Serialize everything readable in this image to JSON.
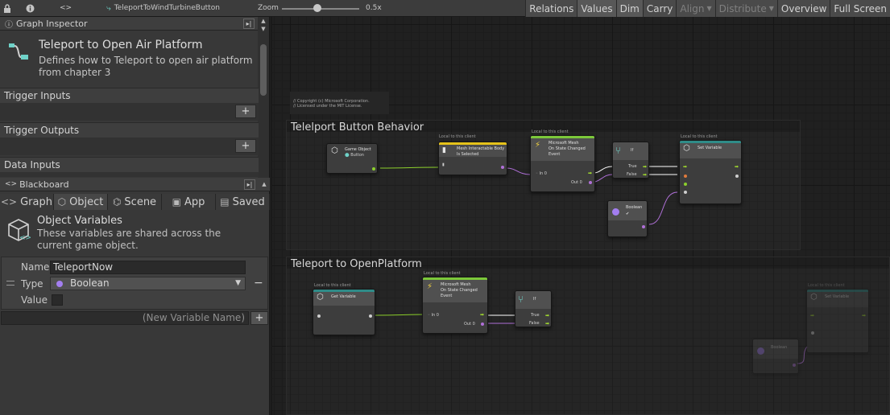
{
  "toolbar": {
    "lock_icon": "lock-icon",
    "info_icon": "info-icon",
    "code_tag": "<>",
    "breadcrumb": "TeleportToWindTurbineButton",
    "zoom_label": "Zoom",
    "zoom_value": "0.5x",
    "buttons": [
      "Relations",
      "Values",
      "Dim",
      "Carry",
      "Align",
      "Distribute",
      "Overview",
      "Full Screen"
    ]
  },
  "graph_inspector": {
    "header": "Graph Inspector",
    "title": "Teleport to Open Air Platform",
    "description": "Defines how to Teleport to open air platform from chapter 3",
    "sections": [
      "Trigger Inputs",
      "Trigger Outputs",
      "Data Inputs"
    ],
    "add": "+"
  },
  "blackboard": {
    "header": "Blackboard",
    "tabs": [
      "Graph",
      "Object",
      "Scene",
      "App",
      "Saved"
    ],
    "active_tab": "Object",
    "title": "Object Variables",
    "description": "These variables are shared across the current game object.",
    "variable": {
      "name_label": "Name",
      "name_value": "TeleportNow",
      "type_label": "Type",
      "type_value": "Boolean",
      "value_label": "Value",
      "remove": "−"
    },
    "new_variable_placeholder": "(New Variable Name)",
    "add": "+"
  },
  "graph": {
    "comment": "// Copyright (c) Microsoft Corporation.\n// Licensed under the MIT License.",
    "group1": {
      "title": "Telelport Button Behavior",
      "game_object": {
        "title": "Game Object",
        "sub": "Button"
      },
      "interactable": {
        "tag": "Local to this client",
        "title": "Mesh Interactable Body\nIs Selected"
      },
      "state_changed": {
        "tag": "Local to this client",
        "title": "Microsoft Mesh\nOn State Changed\nEvent",
        "in": "In 0",
        "out": "Out 0"
      },
      "if_node": {
        "title": "If",
        "true": "True",
        "false": "False"
      },
      "boolean": {
        "title": "Boolean",
        "value": "✔"
      },
      "set_variable": {
        "tag": "Local to this client",
        "title": "Set Variable"
      }
    },
    "group2": {
      "title": "Teleport to OpenPlatform",
      "get_variable": {
        "tag": "Local to this client",
        "title": "Get Variable"
      },
      "state_changed": {
        "tag": "Local to this client",
        "title": "Microsoft Mesh\nOn State Changed\nEvent",
        "in": "In 0",
        "out": "Out 0"
      },
      "if_node": {
        "title": "If",
        "true": "True",
        "false": "False"
      },
      "boolean": {
        "title": "Boolean"
      },
      "set_variable": {
        "tag": "Local to this client",
        "title": "Set Variable"
      }
    }
  },
  "colors": {
    "accent_green": "#a6e22e",
    "accent_purple": "#a37ef0",
    "event_bar": "#7cc83a",
    "literal_bar": "#e5c21a",
    "variable_bar": "#2f8c88"
  }
}
